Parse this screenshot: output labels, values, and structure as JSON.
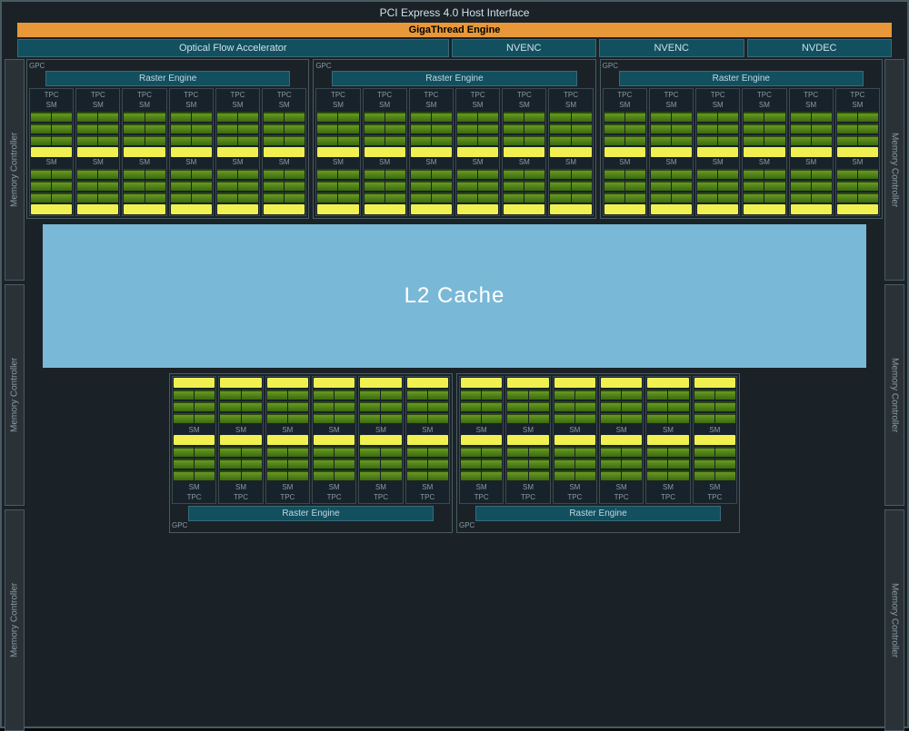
{
  "header": {
    "pci": "PCI Express 4.0 Host Interface",
    "gigathread": "GigaThread Engine"
  },
  "top_units": {
    "ofa": "Optical Flow Accelerator",
    "nvenc": "NVENC",
    "nvdec": "NVDEC"
  },
  "gpc": {
    "label": "GPC",
    "raster": "Raster Engine",
    "tpc": "TPC",
    "sm": "SM"
  },
  "l2": "L2 Cache",
  "memctrl": "Memory Controller",
  "layout": {
    "top_gpc_count": 3,
    "bottom_gpc_count": 2,
    "tpc_per_gpc": 6,
    "sm_per_tpc": 2,
    "memctrl_per_side": 3
  }
}
